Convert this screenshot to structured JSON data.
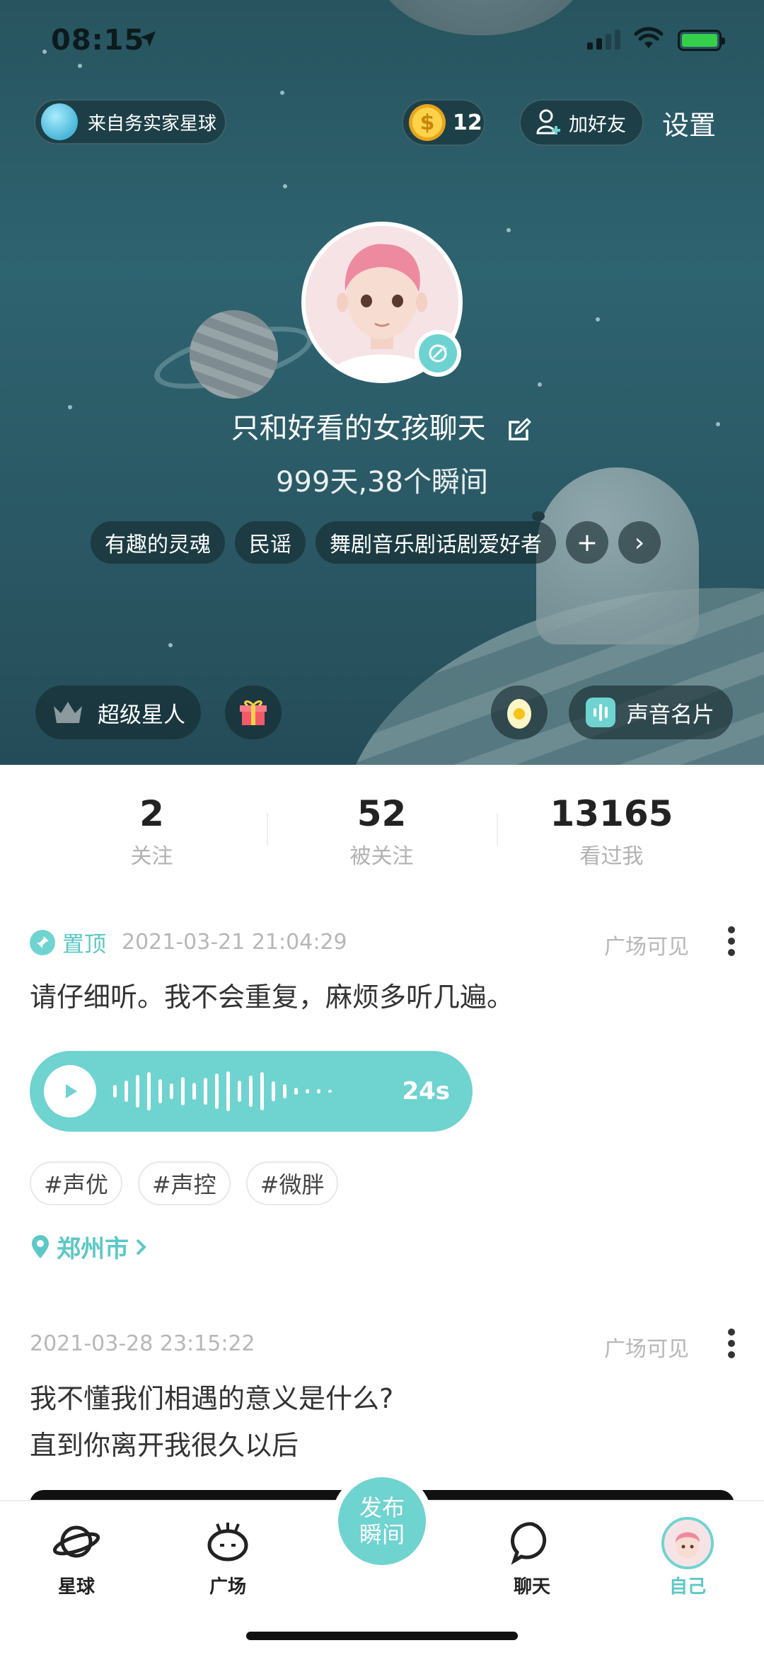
{
  "status_bar": {
    "time": "08:15"
  },
  "header": {
    "planet_label": "来自务实家星球",
    "coins": "12",
    "coin_symbol": "$",
    "add_friend": "加好友",
    "settings": "设置"
  },
  "profile": {
    "nickname": "只和好看的女孩聊天",
    "days_moments": "999天,38个瞬间",
    "tags": [
      "有趣的灵魂",
      "民谣",
      "舞剧音乐剧话剧爱好者"
    ],
    "add_tag": "+",
    "more_tags": "›",
    "superstar": "超级星人",
    "voice_card": "声音名片"
  },
  "stats": [
    {
      "value": "2",
      "label": "关注"
    },
    {
      "value": "52",
      "label": "被关注"
    },
    {
      "value": "13165",
      "label": "看过我"
    }
  ],
  "posts": [
    {
      "pinned_label": "置顶",
      "datetime": "2021-03-21 21:04:29",
      "visibility": "广场可见",
      "text": "请仔细听。我不会重复，麻烦多听几遍。",
      "voice_duration": "24s",
      "hashtags": [
        "#声优",
        "#声控",
        "#微胖"
      ],
      "location": "郑州市"
    },
    {
      "datetime": "2021-03-28 23:15:22",
      "visibility": "广场可见",
      "text_line1": "我不懂我们相遇的意义是什么?",
      "text_line2": "直到你离开我很久以后"
    }
  ],
  "tabbar": {
    "tabs": [
      {
        "label": "星球",
        "icon": "planet-icon"
      },
      {
        "label": "广场",
        "icon": "square-icon"
      },
      {
        "label": "聊天",
        "icon": "chat-icon"
      },
      {
        "label": "自己",
        "icon": "profile-avatar"
      }
    ],
    "publish_line1": "发布",
    "publish_line2": "瞬间"
  },
  "colors": {
    "accent": "#6fd3d0",
    "accent_text": "#5bc8c6",
    "hero_bg": "#2e6370"
  }
}
